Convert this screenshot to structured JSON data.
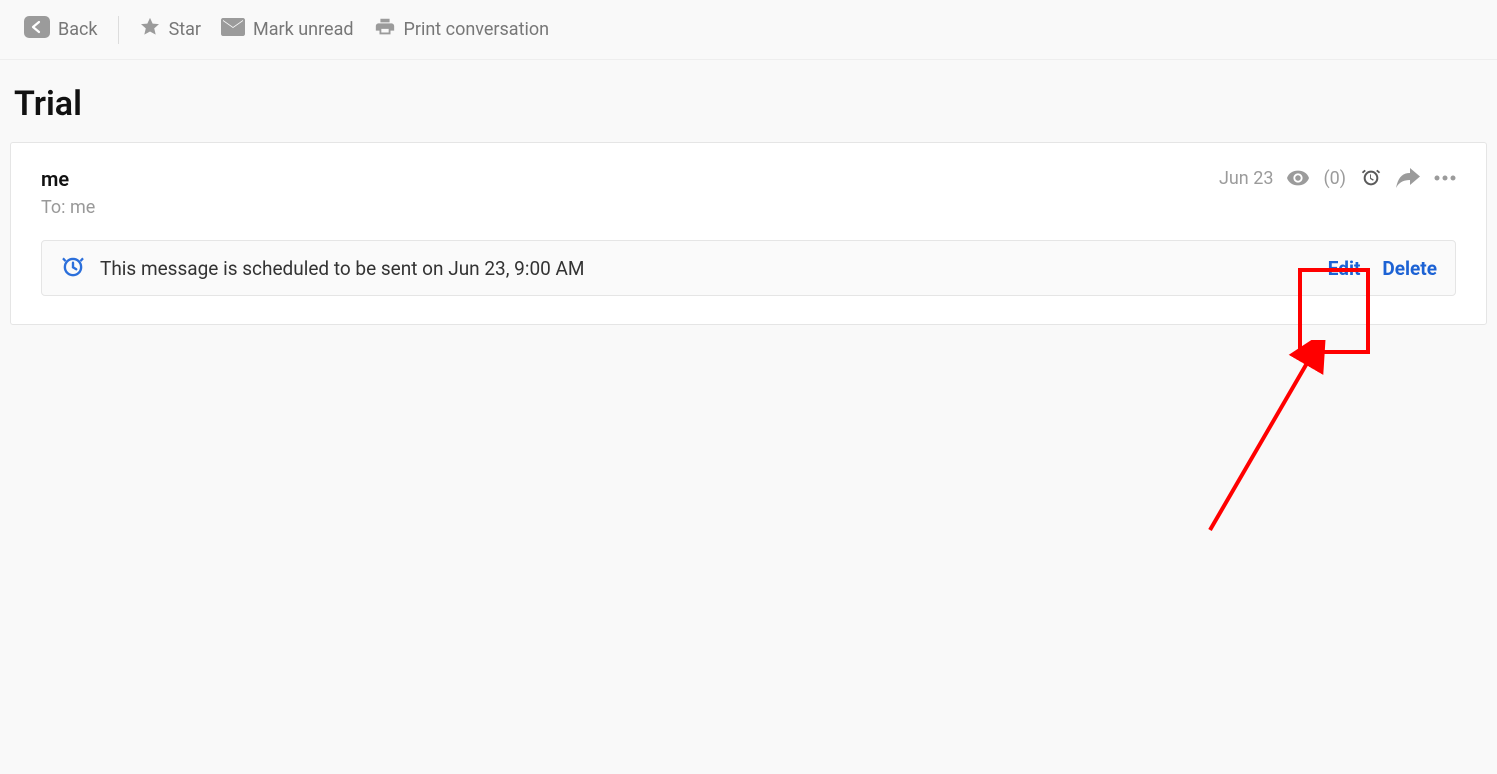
{
  "toolbar": {
    "back": "Back",
    "star": "Star",
    "mark_unread": "Mark unread",
    "print": "Print conversation"
  },
  "subject": "Trial",
  "message": {
    "from": "me",
    "to_label": "To: me",
    "date": "Jun 23",
    "views_count": "(0)"
  },
  "scheduled": {
    "text": "This message is scheduled to be sent on Jun 23, 9:00 AM",
    "edit": "Edit",
    "delete": "Delete"
  }
}
